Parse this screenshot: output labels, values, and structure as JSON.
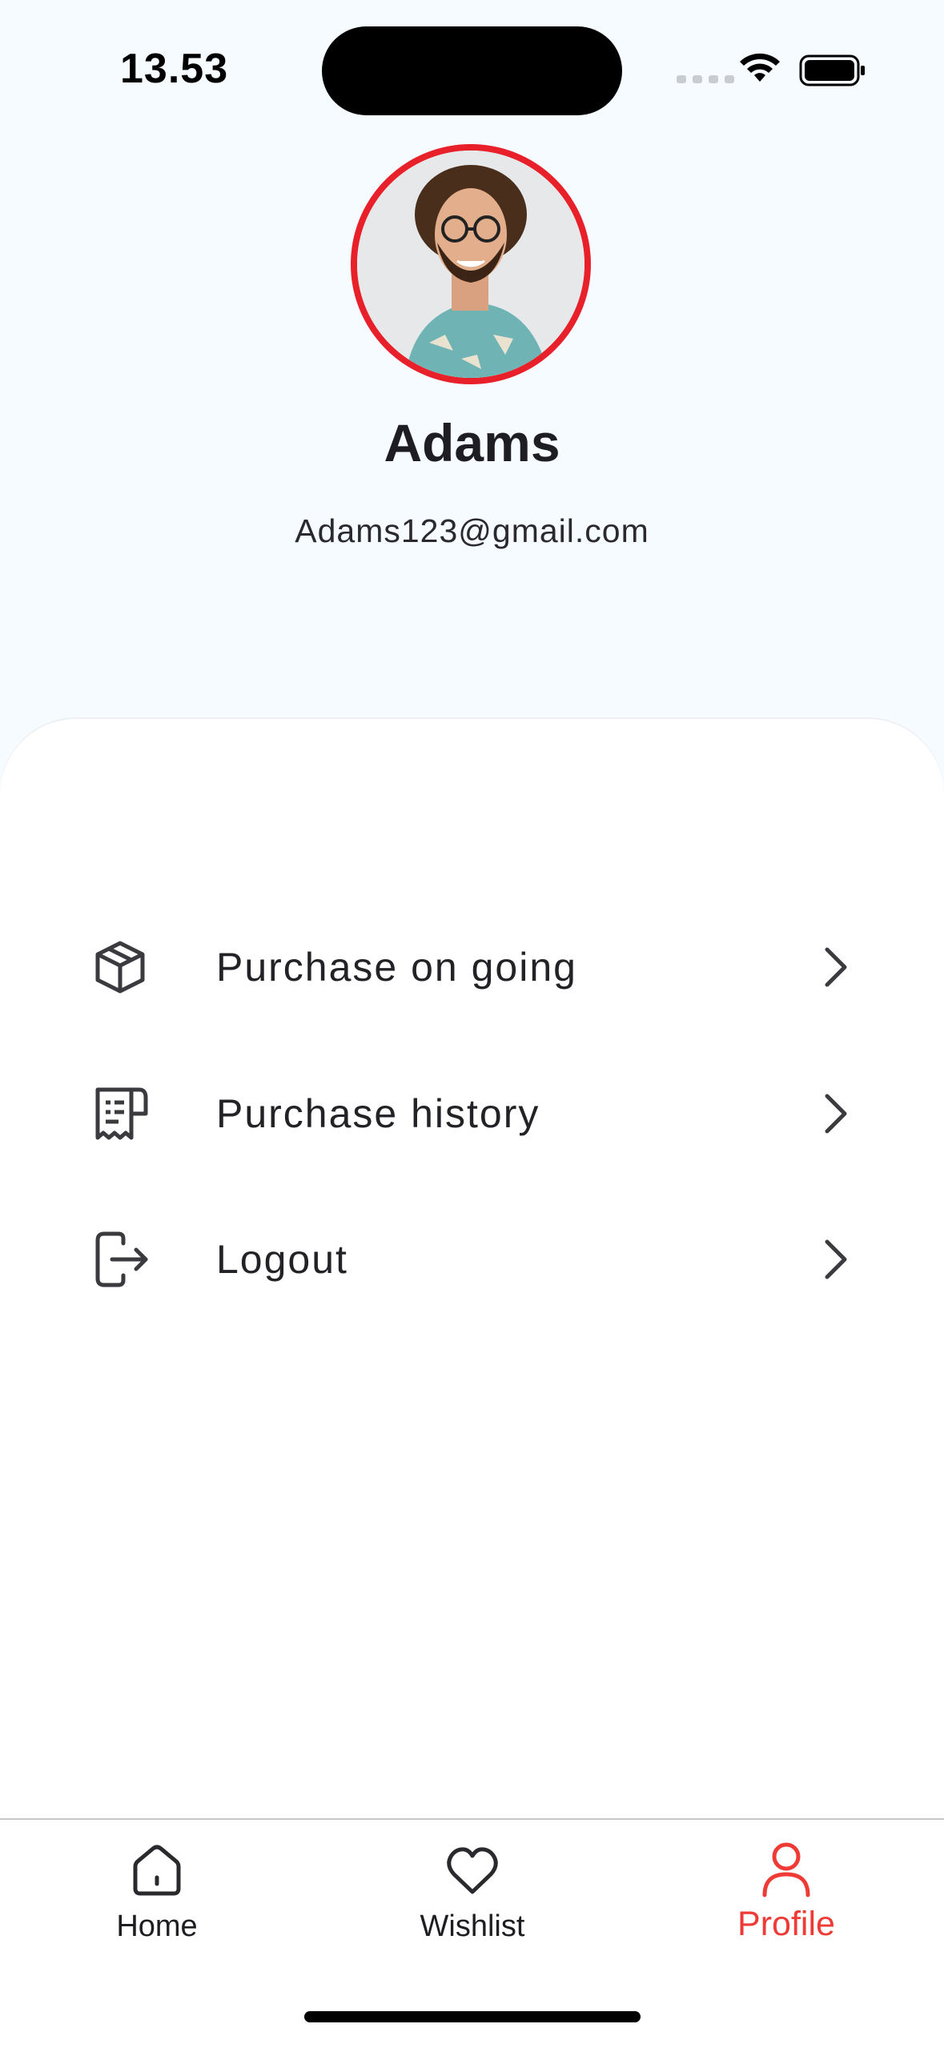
{
  "status_bar": {
    "time": "13.53"
  },
  "profile": {
    "name": "Adams",
    "email": "Adams123@gmail.com"
  },
  "menu": [
    {
      "label": "Purchase on going",
      "icon": "package-icon"
    },
    {
      "label": "Purchase history",
      "icon": "receipt-icon"
    },
    {
      "label": "Logout",
      "icon": "logout-icon"
    }
  ],
  "bottom_nav": {
    "items": [
      {
        "label": "Home",
        "icon": "home-icon",
        "active": false
      },
      {
        "label": "Wishlist",
        "icon": "heart-icon",
        "active": false
      },
      {
        "label": "Profile",
        "icon": "user-icon",
        "active": true
      }
    ]
  },
  "colors": {
    "accent": "#ee3b36",
    "avatar_ring": "#e8202a",
    "background": "#f6fbff",
    "sheet": "#ffffff"
  }
}
